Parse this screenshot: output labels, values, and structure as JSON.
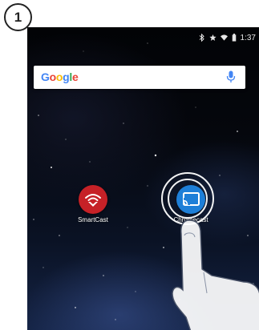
{
  "step": {
    "number": "1"
  },
  "status_bar": {
    "icons": [
      "bluetooth-icon",
      "star-icon",
      "wifi-icon",
      "battery-icon"
    ],
    "time": "1:37"
  },
  "search_widget": {
    "logo_letters": [
      {
        "ch": "G",
        "color": "#4285F4"
      },
      {
        "ch": "o",
        "color": "#EA4335"
      },
      {
        "ch": "o",
        "color": "#FBBC05"
      },
      {
        "ch": "g",
        "color": "#4285F4"
      },
      {
        "ch": "l",
        "color": "#34A853"
      },
      {
        "ch": "e",
        "color": "#EA4335"
      }
    ],
    "mic_color": "#4285F4"
  },
  "apps": [
    {
      "label": "SmartCast",
      "icon": "smartcast-icon",
      "color": "#c62127"
    },
    {
      "label": "Chromecast",
      "icon": "chromecast-icon",
      "color": "#1e7fd8"
    }
  ],
  "overlay": {
    "icon": "tapping-hand-icon"
  }
}
